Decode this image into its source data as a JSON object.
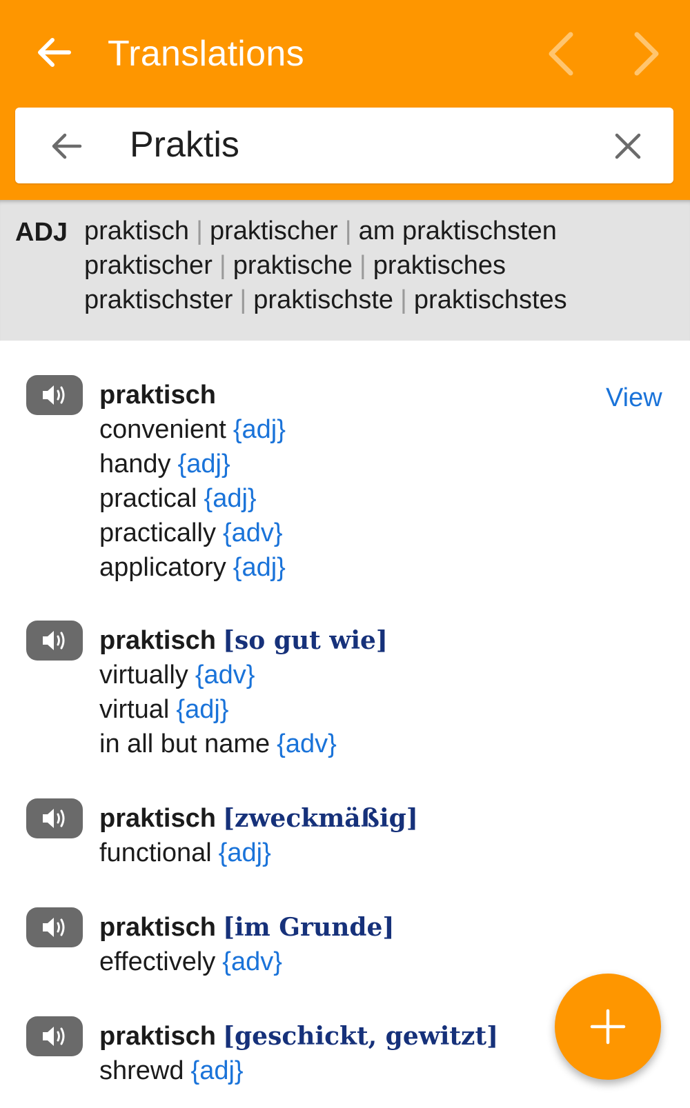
{
  "appbar": {
    "title": "Translations",
    "back_icon": "arrow-left-icon",
    "prev_icon": "chevron-left-icon",
    "next_icon": "chevron-right-icon",
    "color": "#fe9600"
  },
  "search": {
    "value": "Praktis",
    "back_icon": "arrow-left-icon",
    "clear_icon": "close-icon"
  },
  "inflection": {
    "pos": "ADJ",
    "lines": [
      [
        "praktisch",
        "praktischer",
        "am praktischsten"
      ],
      [
        "praktischer",
        "praktische",
        "praktisches"
      ],
      [
        "praktischster",
        "praktischste",
        "praktischstes"
      ]
    ]
  },
  "entries": [
    {
      "headword": "praktisch",
      "context": "",
      "view_label": "View",
      "translations": [
        {
          "word": "convenient",
          "gram": "{adj}"
        },
        {
          "word": "handy",
          "gram": "{adj}"
        },
        {
          "word": "practical",
          "gram": "{adj}"
        },
        {
          "word": "practically",
          "gram": "{adv}"
        },
        {
          "word": "applicatory",
          "gram": "{adj}"
        }
      ]
    },
    {
      "headword": "praktisch",
      "context": "[so gut wie]",
      "translations": [
        {
          "word": "virtually",
          "gram": "{adv}"
        },
        {
          "word": "virtual",
          "gram": "{adj}"
        },
        {
          "word": "in all but name",
          "gram": "{adv}"
        }
      ]
    },
    {
      "headword": "praktisch",
      "context": "[zweckmäßig]",
      "translations": [
        {
          "word": "functional",
          "gram": "{adj}"
        }
      ]
    },
    {
      "headword": "praktisch",
      "context": "[im Grunde]",
      "translations": [
        {
          "word": "effectively",
          "gram": "{adv}"
        }
      ]
    },
    {
      "headword": "praktisch",
      "context": "[geschickt, gewitzt]",
      "translations": [
        {
          "word": "shrewd",
          "gram": "{adj}"
        }
      ]
    }
  ],
  "fab": {
    "icon": "plus-icon"
  },
  "colors": {
    "accent": "#fe9600",
    "link": "#1a73d9",
    "context": "#16317a"
  }
}
